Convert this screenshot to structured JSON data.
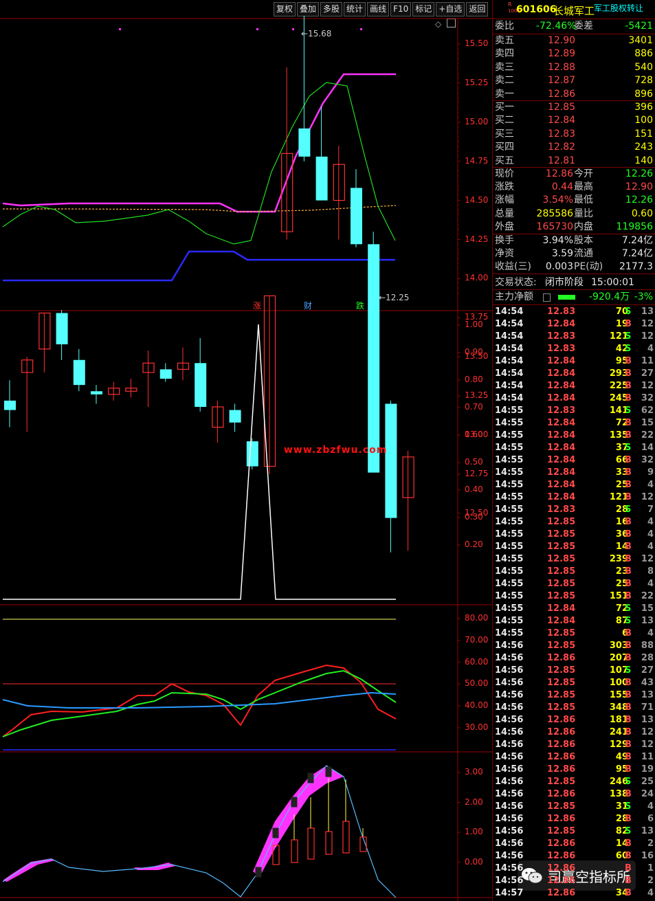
{
  "toolbar": {
    "items": [
      "复权",
      "叠加",
      "多股",
      "统计",
      "画线",
      "F10",
      "标记",
      "+自选",
      "返回"
    ]
  },
  "stock": {
    "r_badge": "R",
    "r_sub": "1000",
    "code": "601606",
    "name": "长城军工",
    "tag": "军工股权转让"
  },
  "order_book": {
    "weibi_label": "委比",
    "weibi_value": "-72.46%",
    "weicha_label": "委差",
    "weicha_value": "-5421",
    "sells": [
      {
        "label": "卖五",
        "price": "12.90",
        "vol": "3401"
      },
      {
        "label": "卖四",
        "price": "12.89",
        "vol": "886"
      },
      {
        "label": "卖三",
        "price": "12.88",
        "vol": "540"
      },
      {
        "label": "卖二",
        "price": "12.87",
        "vol": "728"
      },
      {
        "label": "卖一",
        "price": "12.86",
        "vol": "896"
      }
    ],
    "buys": [
      {
        "label": "买一",
        "price": "12.85",
        "vol": "396"
      },
      {
        "label": "买二",
        "price": "12.84",
        "vol": "100"
      },
      {
        "label": "买三",
        "price": "12.83",
        "vol": "151"
      },
      {
        "label": "买四",
        "price": "12.82",
        "vol": "243"
      },
      {
        "label": "买五",
        "price": "12.81",
        "vol": "140"
      }
    ]
  },
  "quote": {
    "rows": [
      {
        "l1": "现价",
        "v1": "12.86",
        "c1": "red",
        "l2": "今开",
        "v2": "12.26",
        "c2": "green"
      },
      {
        "l1": "涨跌",
        "v1": "0.44",
        "c1": "red",
        "l2": "最高",
        "v2": "12.90",
        "c2": "red"
      },
      {
        "l1": "涨幅",
        "v1": "3.54%",
        "c1": "red",
        "l2": "最低",
        "v2": "12.26",
        "c2": "green"
      },
      {
        "l1": "总量",
        "v1": "285586",
        "c1": "yellow",
        "l2": "量比",
        "v2": "0.60",
        "c2": "yellow"
      },
      {
        "l1": "外盘",
        "v1": "165730",
        "c1": "red",
        "l2": "内盘",
        "v2": "119856",
        "c2": "green"
      }
    ],
    "rows2": [
      {
        "l1": "换手",
        "v1": "3.94%",
        "l2": "股本",
        "v2": "7.24亿"
      },
      {
        "l1": "净资",
        "v1": "3.59",
        "l2": "流通",
        "v2": "7.24亿"
      },
      {
        "l1": "收益(三)",
        "v1": "0.003",
        "l2": "PE(动)",
        "v2": "2177.3"
      }
    ],
    "status_label": "交易状态:",
    "status_value": "闭市阶段",
    "status_time": "15:00:01",
    "main_label": "主力净额",
    "main_value": "-920.4万",
    "main_pct": "-3%"
  },
  "ticks": [
    [
      "14:54",
      "12.83",
      "70",
      "S",
      "13"
    ],
    [
      "14:54",
      "12.84",
      "19",
      "B",
      "12"
    ],
    [
      "14:54",
      "12.83",
      "121",
      "S",
      "12"
    ],
    [
      "14:54",
      "12.83",
      "42",
      "S",
      "4"
    ],
    [
      "14:54",
      "12.84",
      "95",
      "B",
      "11"
    ],
    [
      "14:54",
      "12.84",
      "293",
      "B",
      "27"
    ],
    [
      "14:54",
      "12.84",
      "225",
      "B",
      "12"
    ],
    [
      "14:54",
      "12.84",
      "245",
      "B",
      "32"
    ],
    [
      "14:55",
      "12.83",
      "141",
      "S",
      "62"
    ],
    [
      "14:55",
      "12.84",
      "72",
      "B",
      "15"
    ],
    [
      "14:55",
      "12.84",
      "135",
      "B",
      "22"
    ],
    [
      "14:55",
      "12.84",
      "37",
      "S",
      "14"
    ],
    [
      "14:55",
      "12.84",
      "66",
      "B",
      "32"
    ],
    [
      "14:55",
      "12.84",
      "33",
      "B",
      "9"
    ],
    [
      "14:55",
      "12.84",
      "25",
      "B",
      "4"
    ],
    [
      "14:55",
      "12.84",
      "121",
      "B",
      "12"
    ],
    [
      "14:55",
      "12.83",
      "28",
      "S",
      "7"
    ],
    [
      "14:55",
      "12.85",
      "16",
      "B",
      "4"
    ],
    [
      "14:55",
      "12.85",
      "36",
      "B",
      "4"
    ],
    [
      "14:55",
      "12.85",
      "14",
      "B",
      "4"
    ],
    [
      "14:55",
      "12.85",
      "239",
      "B",
      "12"
    ],
    [
      "14:55",
      "12.85",
      "23",
      "B",
      "8"
    ],
    [
      "14:55",
      "12.85",
      "25",
      "B",
      "4"
    ],
    [
      "14:55",
      "12.85",
      "151",
      "B",
      "22"
    ],
    [
      "14:55",
      "12.84",
      "72",
      "S",
      "15"
    ],
    [
      "14:55",
      "12.84",
      "87",
      "S",
      "13"
    ],
    [
      "14:55",
      "12.85",
      "6",
      "B",
      "4"
    ],
    [
      "14:56",
      "12.85",
      "303",
      "B",
      "88"
    ],
    [
      "14:56",
      "12.86",
      "207",
      "B",
      "28"
    ],
    [
      "14:56",
      "12.85",
      "107",
      "S",
      "27"
    ],
    [
      "14:56",
      "12.85",
      "100",
      "B",
      "43"
    ],
    [
      "14:56",
      "12.85",
      "155",
      "B",
      "13"
    ],
    [
      "14:56",
      "12.85",
      "348",
      "B",
      "71"
    ],
    [
      "14:56",
      "12.86",
      "181",
      "B",
      "13"
    ],
    [
      "14:56",
      "12.86",
      "241",
      "B",
      "12"
    ],
    [
      "14:56",
      "12.86",
      "129",
      "B",
      "12"
    ],
    [
      "14:56",
      "12.86",
      "49",
      "B",
      "11"
    ],
    [
      "14:56",
      "12.86",
      "95",
      "B",
      "19"
    ],
    [
      "14:56",
      "12.85",
      "246",
      "S",
      "25"
    ],
    [
      "14:56",
      "12.86",
      "138",
      "B",
      "24"
    ],
    [
      "14:56",
      "12.85",
      "31",
      "S",
      "4"
    ],
    [
      "14:56",
      "12.86",
      "28",
      "B",
      "6"
    ],
    [
      "14:56",
      "12.85",
      "82",
      "S",
      "13"
    ],
    [
      "14:56",
      "12.86",
      "14",
      "B",
      "2"
    ],
    [
      "14:56",
      "12.86",
      "60",
      "B",
      "16"
    ],
    [
      "14:56",
      "12.86",
      "",
      "B",
      "1"
    ],
    [
      "14:56",
      "12.86",
      "",
      "B",
      "2"
    ],
    [
      "14:57",
      "12.86",
      "34",
      "B",
      "4"
    ]
  ],
  "chart": {
    "price_axis": [
      "15.50",
      "15.25",
      "15.00",
      "14.75",
      "14.50",
      "14.25",
      "14.00",
      "13.75",
      "13.50",
      "13.25",
      "13.00",
      "12.75",
      "12.50"
    ],
    "high_label": "15.68",
    "low_label": "12.25",
    "markers": [
      {
        "text": "涨",
        "color": "#ff3030"
      },
      {
        "text": "财",
        "color": "#4aa0ff"
      },
      {
        "text": "跌",
        "color": "#22ff22"
      }
    ],
    "pane2_axis": [
      "1.00",
      "0.90",
      "0.80",
      "0.70",
      "0.60",
      "0.50",
      "0.40",
      "0.30",
      "0.20"
    ],
    "pane3_axis": [
      "80.00",
      "70.00",
      "60.00",
      "50.00",
      "40.00",
      "30.00"
    ],
    "pane4_axis": [
      "3.00",
      "2.00",
      "1.00",
      "0.00"
    ],
    "watermark": "www.zbzfwu.com",
    "candles": [
      {
        "o": 13.22,
        "c": 13.16,
        "h": 13.35,
        "l": 13.05
      },
      {
        "o": 13.4,
        "c": 13.48,
        "h": 13.5,
        "l": 13.02
      },
      {
        "o": 13.55,
        "c": 13.78,
        "h": 13.78,
        "l": 13.4
      },
      {
        "o": 13.78,
        "c": 13.58,
        "h": 13.8,
        "l": 13.48
      },
      {
        "o": 13.48,
        "c": 13.32,
        "h": 13.55,
        "l": 13.28
      },
      {
        "o": 13.28,
        "c": 13.26,
        "h": 13.32,
        "l": 13.2
      },
      {
        "o": 13.26,
        "c": 13.3,
        "h": 13.34,
        "l": 13.22
      },
      {
        "o": 13.28,
        "c": 13.3,
        "h": 13.36,
        "l": 13.24
      },
      {
        "o": 13.4,
        "c": 13.46,
        "h": 13.54,
        "l": 13.18
      },
      {
        "o": 13.42,
        "c": 13.36,
        "h": 13.46,
        "l": 13.34
      },
      {
        "o": 13.42,
        "c": 13.46,
        "h": 13.56,
        "l": 13.35
      },
      {
        "o": 13.46,
        "c": 13.18,
        "h": 13.62,
        "l": 13.15
      },
      {
        "o": 13.05,
        "c": 13.18,
        "h": 13.22,
        "l": 12.95
      },
      {
        "o": 13.16,
        "c": 13.08,
        "h": 13.2,
        "l": 13.02
      },
      {
        "o": 12.96,
        "c": 12.8,
        "h": 12.98,
        "l": 12.78
      },
      {
        "o": 12.8,
        "c": 13.89,
        "h": 13.89,
        "l": 12.75
      },
      {
        "o": 14.3,
        "c": 14.8,
        "h": 15.35,
        "l": 14.25
      },
      {
        "o": 14.96,
        "c": 14.78,
        "h": 15.68,
        "l": 14.75
      },
      {
        "o": 14.78,
        "c": 14.5,
        "h": 15.1,
        "l": 14.5
      },
      {
        "o": 14.5,
        "c": 14.73,
        "h": 14.85,
        "l": 14.25
      },
      {
        "o": 14.58,
        "c": 14.22,
        "h": 14.7,
        "l": 14.2
      },
      {
        "o": 14.22,
        "c": 12.76,
        "h": 14.3,
        "l": 12.76
      },
      {
        "o": 13.2,
        "c": 12.47,
        "h": 13.22,
        "l": 12.25
      },
      {
        "o": 12.6,
        "c": 12.86,
        "h": 12.9,
        "l": 12.26
      }
    ]
  }
}
